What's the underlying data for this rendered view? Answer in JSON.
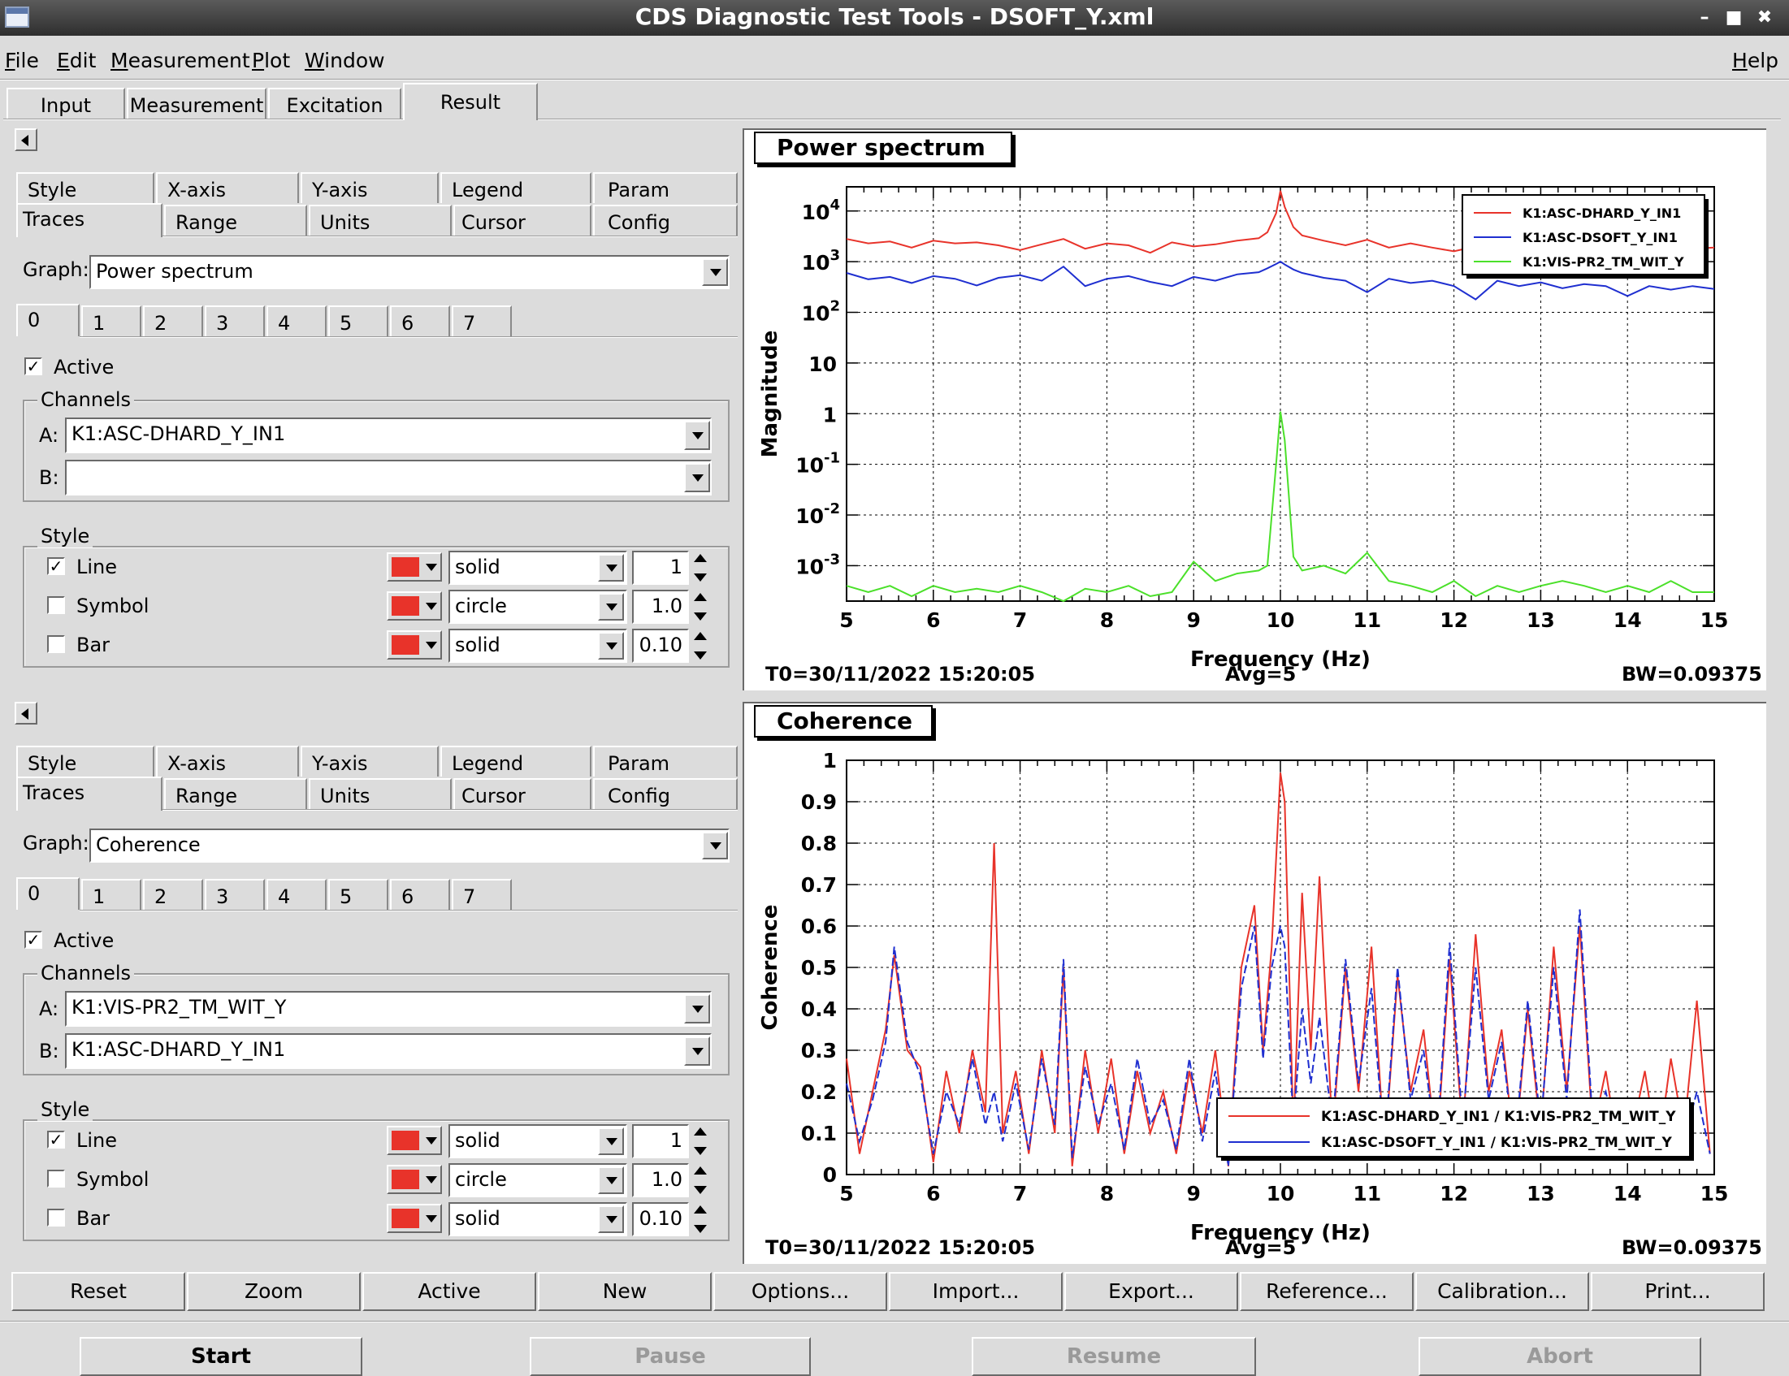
{
  "window": {
    "title": "CDS Diagnostic Test Tools - DSOFT_Y.xml",
    "controls": [
      "minimize",
      "maximize",
      "close"
    ]
  },
  "menubar": {
    "items": [
      "File",
      "Edit",
      "Measurement",
      "Plot",
      "Window"
    ],
    "help": "Help"
  },
  "main_tabs": {
    "items": [
      "Input",
      "Measurement",
      "Excitation",
      "Result"
    ],
    "selected": "Result"
  },
  "panels": [
    {
      "options_tabs_row1": [
        "Style",
        "X-axis",
        "Y-axis",
        "Legend",
        "Param"
      ],
      "options_tabs_row2": [
        "Traces",
        "Range",
        "Units",
        "Cursor",
        "Config"
      ],
      "selected_tab": "Traces",
      "graph_label": "Graph:",
      "graph_value": "Power spectrum",
      "trace_tabs": [
        "0",
        "1",
        "2",
        "3",
        "4",
        "5",
        "6",
        "7"
      ],
      "active_label": "Active",
      "active_checked": true,
      "channels_label": "Channels",
      "channel_a_label": "A:",
      "channel_a": "K1:ASC-DHARD_Y_IN1",
      "channel_b_label": "B:",
      "channel_b": "",
      "style_label": "Style",
      "style_rows": [
        {
          "label": "Line",
          "checked": true,
          "color": "#e8332a",
          "type": "solid",
          "size": "1"
        },
        {
          "label": "Symbol",
          "checked": false,
          "color": "#e8332a",
          "type": "circle",
          "size": "1.0"
        },
        {
          "label": "Bar",
          "checked": false,
          "color": "#e8332a",
          "type": "solid",
          "size": "0.10"
        }
      ]
    },
    {
      "options_tabs_row1": [
        "Style",
        "X-axis",
        "Y-axis",
        "Legend",
        "Param"
      ],
      "options_tabs_row2": [
        "Traces",
        "Range",
        "Units",
        "Cursor",
        "Config"
      ],
      "selected_tab": "Traces",
      "graph_label": "Graph:",
      "graph_value": "Coherence",
      "trace_tabs": [
        "0",
        "1",
        "2",
        "3",
        "4",
        "5",
        "6",
        "7"
      ],
      "active_label": "Active",
      "active_checked": true,
      "channels_label": "Channels",
      "channel_a_label": "A:",
      "channel_a": "K1:VIS-PR2_TM_WIT_Y",
      "channel_b_label": "B:",
      "channel_b": "K1:ASC-DHARD_Y_IN1",
      "style_label": "Style",
      "style_rows": [
        {
          "label": "Line",
          "checked": true,
          "color": "#e8332a",
          "type": "solid",
          "size": "1"
        },
        {
          "label": "Symbol",
          "checked": false,
          "color": "#e8332a",
          "type": "circle",
          "size": "1.0"
        },
        {
          "label": "Bar",
          "checked": false,
          "color": "#e8332a",
          "type": "solid",
          "size": "0.10"
        }
      ]
    }
  ],
  "plot_footers": [
    {
      "t0": "T0=30/11/2022 15:20:05",
      "avg": "Avg=5",
      "bw": "BW=0.09375"
    },
    {
      "t0": "T0=30/11/2022 15:20:05",
      "avg": "Avg=5",
      "bw": "BW=0.09375"
    }
  ],
  "chart_data": [
    {
      "type": "line",
      "title": "Power spectrum",
      "xlabel": "Frequency (Hz)",
      "ylabel": "Magnitude",
      "xlim": [
        5,
        15
      ],
      "ylim": [
        0.0002,
        30000
      ],
      "yscale": "log",
      "grid": true,
      "legend_position": "top-right",
      "x_ticks": [
        "5",
        "6",
        "7",
        "8",
        "9",
        "10",
        "11",
        "12",
        "13",
        "14",
        "15"
      ],
      "y_ticks": [
        {
          "value": 10000,
          "base": "10",
          "exp": "4"
        },
        {
          "value": 1000,
          "base": "10",
          "exp": "3"
        },
        {
          "value": 100,
          "base": "10",
          "exp": "2"
        },
        {
          "value": 10,
          "base": "10",
          "exp": ""
        },
        {
          "value": 1,
          "base": "1",
          "exp": ""
        },
        {
          "value": 0.1,
          "base": "10",
          "exp": "-1"
        },
        {
          "value": 0.01,
          "base": "10",
          "exp": "-2"
        },
        {
          "value": 0.001,
          "base": "10",
          "exp": "-3"
        }
      ],
      "x": [
        5.0,
        5.25,
        5.5,
        5.75,
        6.0,
        6.25,
        6.5,
        6.75,
        7.0,
        7.25,
        7.5,
        7.75,
        8.0,
        8.25,
        8.5,
        8.75,
        9.0,
        9.25,
        9.5,
        9.75,
        9.85,
        9.95,
        10.0,
        10.05,
        10.15,
        10.25,
        10.5,
        10.75,
        11.0,
        11.25,
        11.5,
        11.75,
        12.0,
        12.25,
        12.5,
        12.75,
        13.0,
        13.25,
        13.5,
        13.75,
        14.0,
        14.25,
        14.5,
        14.75,
        15.0
      ],
      "series": [
        {
          "name": "K1:ASC-DHARD_Y_IN1",
          "color": "#e8332a",
          "values": [
            2800,
            2300,
            2500,
            1900,
            2600,
            2300,
            2400,
            2100,
            1700,
            2200,
            2800,
            1800,
            2300,
            2100,
            1500,
            2400,
            2000,
            2200,
            2600,
            2900,
            3800,
            9000,
            25000,
            12000,
            4800,
            3300,
            2600,
            2100,
            2700,
            1900,
            2300,
            1900,
            1600,
            2000,
            2300,
            1900,
            2100,
            1800,
            2200,
            2500,
            1900,
            2300,
            2100,
            1800,
            1900
          ]
        },
        {
          "name": "K1:ASC-DSOFT_Y_IN1",
          "color": "#1f2fd0",
          "values": [
            600,
            450,
            500,
            380,
            520,
            460,
            340,
            480,
            540,
            420,
            800,
            330,
            460,
            520,
            400,
            330,
            500,
            420,
            560,
            620,
            740,
            900,
            1000,
            880,
            700,
            600,
            480,
            420,
            250,
            460,
            380,
            420,
            330,
            180,
            420,
            330,
            390,
            300,
            360,
            330,
            210,
            330,
            280,
            330,
            290
          ]
        },
        {
          "name": "K1:VIS-PR2_TM_WIT_Y",
          "color": "#4be02a",
          "values": [
            0.0004,
            0.0003,
            0.0004,
            0.00025,
            0.0004,
            0.0003,
            0.00035,
            0.0003,
            0.0004,
            0.0003,
            0.0002,
            0.00035,
            0.0003,
            0.0004,
            0.00025,
            0.0003,
            0.0012,
            0.0005,
            0.0007,
            0.0008,
            0.001,
            0.1,
            1.1,
            0.3,
            0.0015,
            0.0008,
            0.001,
            0.0007,
            0.0018,
            0.0005,
            0.0004,
            0.0003,
            0.0005,
            0.00025,
            0.0004,
            0.0003,
            0.0004,
            0.0005,
            0.0004,
            0.0003,
            0.0004,
            0.0003,
            0.0005,
            0.0003,
            0.0003
          ]
        }
      ]
    },
    {
      "type": "line",
      "title": "Coherence",
      "xlabel": "Frequency (Hz)",
      "ylabel": "Coherence",
      "xlim": [
        5,
        15
      ],
      "ylim": [
        0,
        1
      ],
      "grid": true,
      "legend_position": "bottom-right",
      "x_ticks": [
        "5",
        "6",
        "7",
        "8",
        "9",
        "10",
        "11",
        "12",
        "13",
        "14",
        "15"
      ],
      "y_ticks": [
        "0",
        "0.1",
        "0.2",
        "0.3",
        "0.4",
        "0.5",
        "0.6",
        "0.7",
        "0.8",
        "0.9",
        "1"
      ],
      "x": [
        5.0,
        5.15,
        5.3,
        5.45,
        5.55,
        5.7,
        5.85,
        6.0,
        6.15,
        6.3,
        6.45,
        6.6,
        6.7,
        6.8,
        6.95,
        7.1,
        7.25,
        7.4,
        7.5,
        7.6,
        7.75,
        7.9,
        8.05,
        8.2,
        8.35,
        8.5,
        8.65,
        8.8,
        8.95,
        9.1,
        9.25,
        9.4,
        9.55,
        9.7,
        9.8,
        9.9,
        10.0,
        10.05,
        10.15,
        10.25,
        10.35,
        10.45,
        10.6,
        10.75,
        10.9,
        11.05,
        11.2,
        11.35,
        11.5,
        11.65,
        11.8,
        11.95,
        12.1,
        12.25,
        12.4,
        12.55,
        12.7,
        12.85,
        13.0,
        13.15,
        13.3,
        13.45,
        13.6,
        13.75,
        13.9,
        14.05,
        14.2,
        14.35,
        14.5,
        14.65,
        14.8,
        14.95
      ],
      "series": [
        {
          "name": "K1:ASC-DHARD_Y_IN1 / K1:VIS-PR2_TM_WIT_Y",
          "color": "#e8332a",
          "values": [
            0.28,
            0.05,
            0.2,
            0.35,
            0.53,
            0.3,
            0.26,
            0.03,
            0.25,
            0.1,
            0.3,
            0.15,
            0.8,
            0.1,
            0.25,
            0.05,
            0.3,
            0.1,
            0.5,
            0.02,
            0.3,
            0.1,
            0.28,
            0.05,
            0.25,
            0.1,
            0.2,
            0.05,
            0.25,
            0.1,
            0.3,
            0.02,
            0.5,
            0.65,
            0.3,
            0.55,
            0.97,
            0.9,
            0.1,
            0.68,
            0.3,
            0.72,
            0.1,
            0.5,
            0.2,
            0.55,
            0.05,
            0.48,
            0.2,
            0.35,
            0.05,
            0.52,
            0.1,
            0.58,
            0.2,
            0.35,
            0.05,
            0.4,
            0.1,
            0.55,
            0.2,
            0.6,
            0.1,
            0.25,
            0.05,
            0.1,
            0.25,
            0.05,
            0.28,
            0.1,
            0.42,
            0.05
          ]
        },
        {
          "name": "K1:ASC-DSOFT_Y_IN1 / K1:VIS-PR2_TM_WIT_Y",
          "color": "#1f2fd0",
          "values": [
            0.22,
            0.08,
            0.18,
            0.32,
            0.55,
            0.32,
            0.24,
            0.05,
            0.2,
            0.12,
            0.28,
            0.12,
            0.2,
            0.08,
            0.22,
            0.06,
            0.28,
            0.12,
            0.52,
            0.04,
            0.26,
            0.12,
            0.22,
            0.06,
            0.28,
            0.12,
            0.18,
            0.06,
            0.28,
            0.08,
            0.25,
            0.02,
            0.45,
            0.6,
            0.28,
            0.5,
            0.6,
            0.55,
            0.12,
            0.4,
            0.22,
            0.38,
            0.12,
            0.52,
            0.22,
            0.45,
            0.06,
            0.5,
            0.18,
            0.3,
            0.06,
            0.56,
            0.12,
            0.5,
            0.18,
            0.32,
            0.06,
            0.42,
            0.12,
            0.5,
            0.18,
            0.64,
            0.12,
            0.2,
            0.06,
            0.08,
            0.12,
            0.05,
            0.18,
            0.08,
            0.2,
            0.05
          ]
        }
      ]
    }
  ],
  "plot_toolbar": [
    "Reset",
    "Zoom",
    "Active",
    "New",
    "Options...",
    "Import...",
    "Export...",
    "Reference...",
    "Calibration...",
    "Print..."
  ],
  "control_buttons": [
    {
      "label": "Start",
      "enabled": true
    },
    {
      "label": "Pause",
      "enabled": false
    },
    {
      "label": "Resume",
      "enabled": false
    },
    {
      "label": "Abort",
      "enabled": false
    }
  ]
}
